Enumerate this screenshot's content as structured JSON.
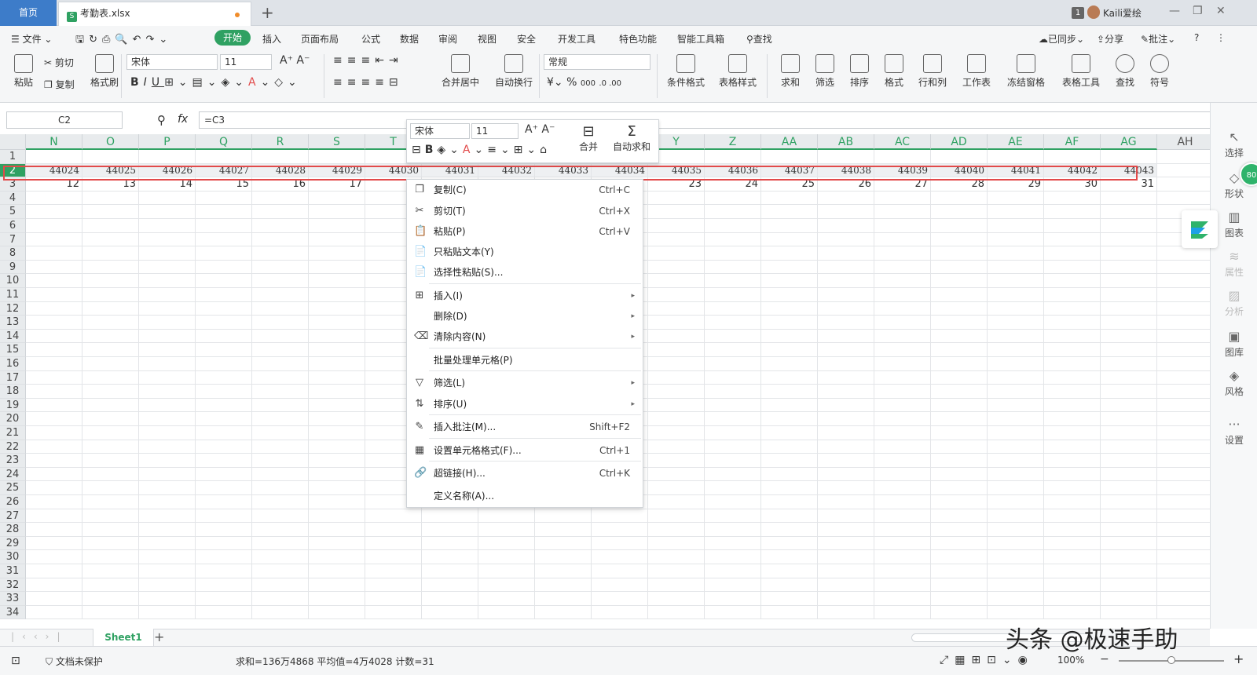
{
  "tabbar": {
    "home": "首页",
    "doc": "考勤表.xlsx",
    "page_badge": "1",
    "user": "Kaili爱绘"
  },
  "menubar": {
    "file": "文件",
    "items": [
      "开始",
      "插入",
      "页面布局",
      "公式",
      "数据",
      "审阅",
      "视图",
      "安全",
      "开发工具",
      "特色功能",
      "智能工具箱"
    ],
    "search": "查找",
    "right": [
      "已同步",
      "分享",
      "批注",
      "?"
    ]
  },
  "ribbon": {
    "paste": "粘贴",
    "cut": "剪切",
    "copy": "复制",
    "format_painter": "格式刷",
    "font": "宋体",
    "size": "11",
    "merge": "合并居中",
    "wrap": "自动换行",
    "number_format": "常规",
    "percent": "%",
    "thousand": "000",
    "inc_dec": ".0 .00",
    "groups": [
      "条件格式",
      "表格样式",
      "求和",
      "筛选",
      "排序",
      "格式",
      "行和列",
      "工作表",
      "冻结窗格",
      "表格工具",
      "查找",
      "符号"
    ]
  },
  "formula": {
    "namebox": "C2",
    "fx": "fx",
    "content": "=C3"
  },
  "columns": [
    "N",
    "O",
    "P",
    "Q",
    "R",
    "S",
    "T",
    "U",
    "V",
    "W",
    "X",
    "Y",
    "Z",
    "AA",
    "AB",
    "AC",
    "AD",
    "AE",
    "AF",
    "AG",
    "AH"
  ],
  "rows": [
    "1",
    "2",
    "3",
    "4",
    "5",
    "6",
    "7",
    "8",
    "9",
    "10",
    "11",
    "12",
    "13",
    "14",
    "15",
    "16",
    "17",
    "18",
    "19",
    "20",
    "21",
    "22",
    "23",
    "24",
    "25",
    "26",
    "27",
    "28",
    "29",
    "30",
    "31",
    "32",
    "33",
    "34"
  ],
  "row2": [
    "44024",
    "44025",
    "44026",
    "44027",
    "44028",
    "44029",
    "44030",
    "44031",
    "44032",
    "44033",
    "44034",
    "44035",
    "44036",
    "44037",
    "44038",
    "44039",
    "44040",
    "44041",
    "44042",
    "44043"
  ],
  "row3": [
    "12",
    "13",
    "14",
    "15",
    "16",
    "17",
    "1",
    "",
    "",
    "",
    "",
    "23",
    "24",
    "25",
    "26",
    "27",
    "28",
    "29",
    "30",
    "31"
  ],
  "mini_toolbar": {
    "font": "宋体",
    "size": "11",
    "merge": "合并",
    "autosum": "自动求和",
    "bold": "B"
  },
  "context_menu": [
    {
      "icon": "copy-icon",
      "glyph": "❐",
      "label": "复制(C)",
      "shortcut": "Ctrl+C"
    },
    {
      "icon": "cut-icon",
      "glyph": "✂",
      "label": "剪切(T)",
      "shortcut": "Ctrl+X"
    },
    {
      "icon": "paste-icon",
      "glyph": "📋",
      "label": "粘贴(P)",
      "shortcut": "Ctrl+V"
    },
    {
      "icon": "paste-text-icon",
      "glyph": "📄",
      "label": "只粘贴文本(Y)",
      "shortcut": ""
    },
    {
      "icon": "paste-special-icon",
      "glyph": "📄",
      "label": "选择性粘贴(S)...",
      "shortcut": ""
    },
    {
      "icon": "insert-icon",
      "glyph": "⊞",
      "label": "插入(I)",
      "shortcut": "",
      "arrow": "▸"
    },
    {
      "icon": "",
      "glyph": "",
      "label": "删除(D)",
      "shortcut": "",
      "arrow": "▸"
    },
    {
      "icon": "clear-icon",
      "glyph": "⌫",
      "label": "清除内容(N)",
      "shortcut": "",
      "arrow": "▸"
    },
    {
      "icon": "",
      "glyph": "",
      "label": "批量处理单元格(P)",
      "shortcut": ""
    },
    {
      "icon": "filter-icon",
      "glyph": "▽",
      "label": "筛选(L)",
      "shortcut": "",
      "arrow": "▸"
    },
    {
      "icon": "sort-icon",
      "glyph": "⇅",
      "label": "排序(U)",
      "shortcut": "",
      "arrow": "▸"
    },
    {
      "icon": "comment-icon",
      "glyph": "✎",
      "label": "插入批注(M)...",
      "shortcut": "Shift+F2"
    },
    {
      "icon": "format-cell-icon",
      "glyph": "▦",
      "label": "设置单元格格式(F)...",
      "shortcut": "Ctrl+1"
    },
    {
      "icon": "link-icon",
      "glyph": "🔗",
      "label": "超链接(H)...",
      "shortcut": "Ctrl+K"
    },
    {
      "icon": "",
      "glyph": "",
      "label": "定义名称(A)...",
      "shortcut": ""
    }
  ],
  "sidebar": [
    "选择",
    "形状",
    "图表",
    "属性",
    "分析",
    "图库",
    "风格",
    "设置"
  ],
  "green_badge": "80",
  "sheet": {
    "name": "Sheet1"
  },
  "status": {
    "protect": "文档未保护",
    "stats": "求和=136万4868   平均值=4万4028   计数=31",
    "zoom": "100%"
  },
  "watermark": "头条 @极速手助",
  "colors": {
    "green": "#2fa162",
    "red": "#e24a4a",
    "blue": "#3d7cc9"
  }
}
